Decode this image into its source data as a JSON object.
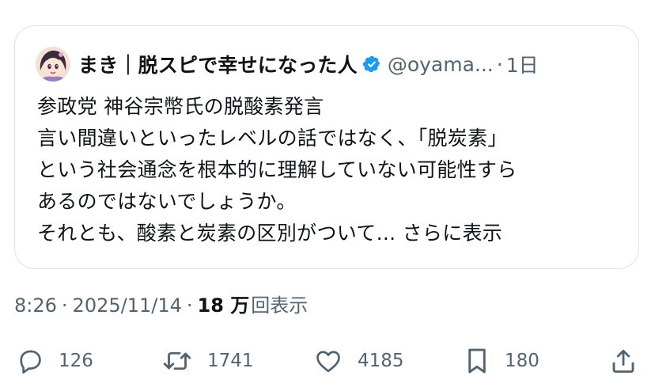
{
  "quoted_tweet": {
    "author": {
      "display_name": "まき｜脱スピで幸せになった人",
      "handle": "@oyama...",
      "verified": true,
      "verified_color": "#1d9bf0"
    },
    "time_separator": "·",
    "time_ago": "1日",
    "text_lines": [
      "参政党 神谷宗幣氏の脱酸素発言",
      "言い間違いといったレベルの話ではなく、「脱炭素」",
      "という社会通念を根本的に理解していない可能性すら",
      "あるのではないでしょうか。",
      "それとも、酸素と炭素の区別がついて..."
    ],
    "show_more_label": "さらに表示"
  },
  "meta": {
    "time": "8:26",
    "sep1": "·",
    "date": "2025/11/14",
    "sep2": "·",
    "views_count": "18 万",
    "views_label": "回表示"
  },
  "actions": {
    "reply": {
      "icon": "reply-icon",
      "count": "126"
    },
    "repost": {
      "icon": "repost-icon",
      "count": "1741"
    },
    "like": {
      "icon": "heart-icon",
      "count": "4185"
    },
    "bookmark": {
      "icon": "bookmark-icon",
      "count": "180"
    },
    "share": {
      "icon": "share-icon"
    }
  },
  "colors": {
    "text_primary": "#0f1419",
    "text_secondary": "#536471",
    "border": "#dfe3e6"
  }
}
